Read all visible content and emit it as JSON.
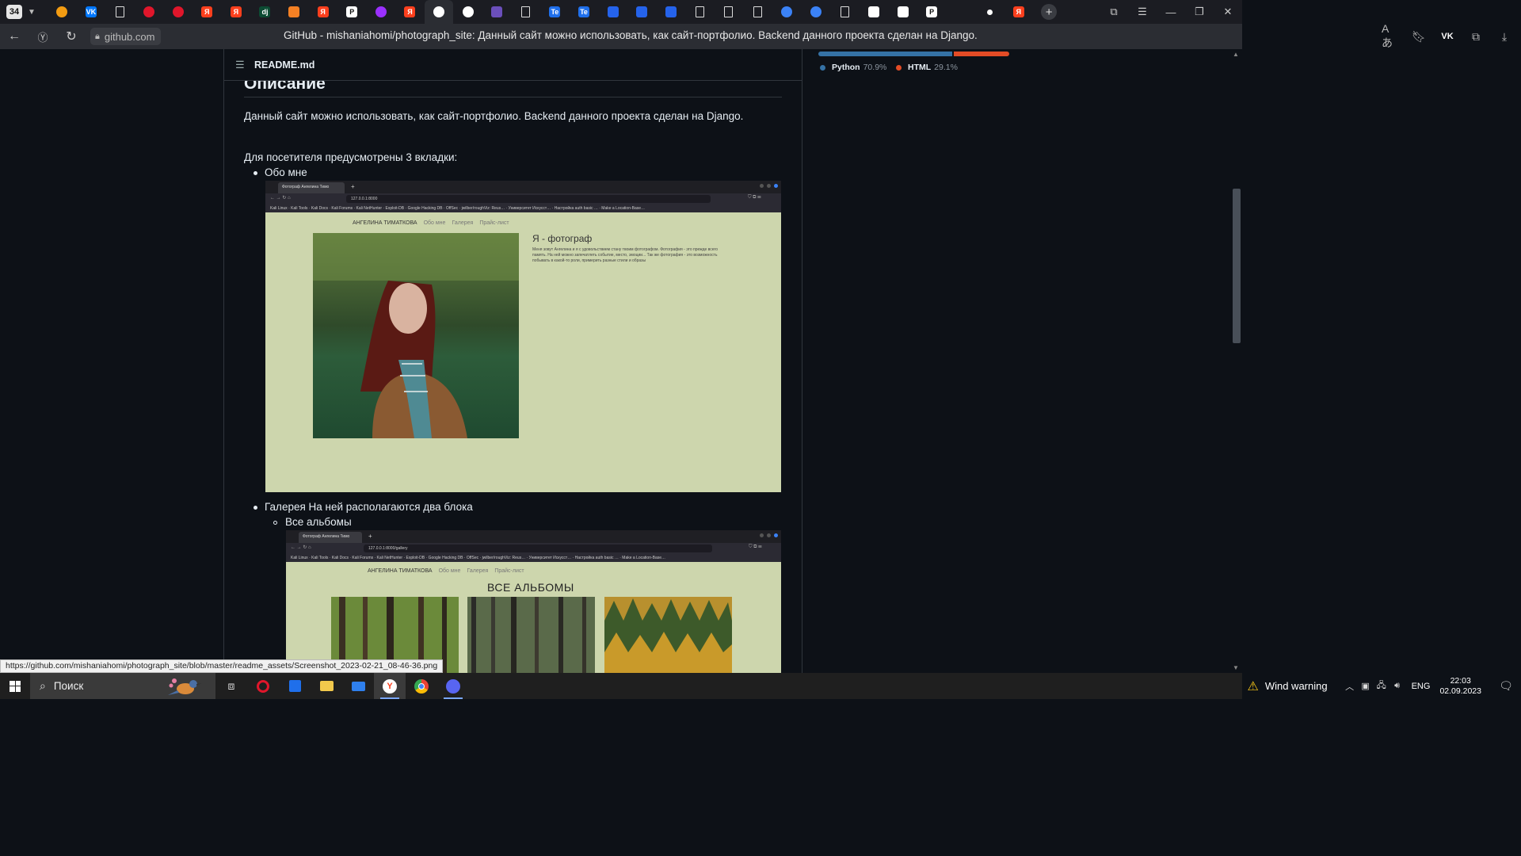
{
  "browser": {
    "tab_count": "34",
    "domain": "github.com",
    "page_title": "GitHub - mishaniahomi/photograph_site: Данный сайт можно использовать, как сайт-портфолио. Backend данного проекта сделан на Django.",
    "tabs": [
      {
        "icon": "cloud-icon",
        "color": "#f39c12",
        "label": ""
      },
      {
        "icon": "vk-icon",
        "color": "#0077ff",
        "label": "VK"
      },
      {
        "icon": "document-icon",
        "color": "",
        "label": ""
      },
      {
        "icon": "opera-icon",
        "color": "#e0162b",
        "label": ""
      },
      {
        "icon": "opera-icon",
        "color": "#e0162b",
        "label": ""
      },
      {
        "icon": "yandex-icon",
        "color": "#fc3f1d",
        "label": "Я"
      },
      {
        "icon": "yandex-icon",
        "color": "#fc3f1d",
        "label": "Я"
      },
      {
        "icon": "dj-icon",
        "color": "#0c4b33",
        "label": "dj"
      },
      {
        "icon": "stackoverflow-icon",
        "color": "#f48024",
        "label": ""
      },
      {
        "icon": "yandex-icon",
        "color": "#fc3f1d",
        "label": "Я"
      },
      {
        "icon": "p-icon",
        "color": "#ffffff",
        "label": "P"
      },
      {
        "icon": "puzzle-icon",
        "color": "#9b30ff",
        "label": ""
      },
      {
        "icon": "yandex-icon",
        "color": "#fc3f1d",
        "label": "Я"
      },
      {
        "icon": "github-icon",
        "color": "#ffffff",
        "label": ""
      },
      {
        "icon": "github-icon",
        "color": "#ffffff",
        "label": ""
      },
      {
        "icon": "banner-icon",
        "color": "#6b4fbb",
        "label": ""
      },
      {
        "icon": "document-icon",
        "color": "",
        "label": ""
      },
      {
        "icon": "te-icon",
        "color": "#1f6feb",
        "label": "Te"
      },
      {
        "icon": "te-icon",
        "color": "#1f6feb",
        "label": "Te"
      },
      {
        "icon": "app-icon",
        "color": "#2563eb",
        "label": ""
      },
      {
        "icon": "app-icon",
        "color": "#2563eb",
        "label": ""
      },
      {
        "icon": "app-icon",
        "color": "#2563eb",
        "label": ""
      },
      {
        "icon": "document-icon",
        "color": "",
        "label": ""
      },
      {
        "icon": "document-icon",
        "color": "",
        "label": ""
      },
      {
        "icon": "document-icon",
        "color": "",
        "label": ""
      },
      {
        "icon": "globe-icon",
        "color": "#3b82f6",
        "label": ""
      },
      {
        "icon": "globe-icon",
        "color": "#3b82f6",
        "label": ""
      },
      {
        "icon": "document-icon",
        "color": "",
        "label": ""
      },
      {
        "icon": "mail-icon",
        "color": "#ffffff",
        "label": ""
      },
      {
        "icon": "chat-icon",
        "color": "#ffffff",
        "label": ""
      },
      {
        "icon": "p-icon",
        "color": "#ffffff",
        "label": "P"
      },
      {
        "icon": "blank-icon",
        "color": "",
        "label": ""
      },
      {
        "icon": "dot-icon",
        "color": "#ffffff",
        "label": ""
      },
      {
        "icon": "yandex-icon",
        "color": "#fc3f1d",
        "label": "Я"
      }
    ],
    "status_url": "https://github.com/mishaniahomi/photograph_site/blob/master/readme_assets/Screenshot_2023-02-21_08-46-36.png"
  },
  "readme": {
    "file_name": "README.md",
    "heading": "Описание",
    "paragraph": "Данный сайт можно использовать, как сайт-портфолио. Backend данного проекта сделан на Django.",
    "tabs_intro": "Для посетителя предусмотрены 3 вкладки:",
    "items": [
      {
        "text": "Обо мне"
      },
      {
        "text": "Галерея На ней располагаются два блока"
      },
      {
        "text": "Все альбомы"
      }
    ]
  },
  "screenshot1": {
    "tab_title": "Фотограф Ангелина Тимо",
    "url": "127.0.0.1:8000",
    "bookmarks": "Kali Linux · Kali Tools · Kali Docs · Kali Forums · Kali NetHunter · Exploit-DB · Google Hacking DB · OffSec · jwilber/roughViz: Reus… · Университет Искусст… · Настройка auth basic … · Make a Location-Base…",
    "brand": "АНГЕЛИНА ТИМАТКОВА",
    "nav": [
      "Обо мне",
      "Галерея",
      "Прайс-лист"
    ],
    "title": "Я - фотограф",
    "text": "Меня зовут Ангелина и я с удовольствием стану твоим фотографом. Фотография - это прежде всего память. На ней можно запечатлеть событие, место, эмоции... Так же фотография - это возможность побывать в какой-то роли, примерить разные стили и образы"
  },
  "screenshot2": {
    "tab_title": "Фотограф Ангелина Тимо",
    "url": "127.0.0.1:8000/gallery",
    "bookmarks": "Kali Linux · Kali Tools · Kali Docs · Kali Forums · Kali NetHunter · Exploit-DB · Google Hacking DB · OffSec · jwilber/roughViz: Reus… · Университет Искусст… · Настройка auth basic … · Make a Location-Base…",
    "brand": "АНГЕЛИНА ТИМАТКОВА",
    "nav": [
      "Обо мне",
      "Галерея",
      "Прайс-лист"
    ],
    "title": "ВСЕ АЛЬБОМЫ"
  },
  "languages": [
    {
      "name": "Python",
      "percent": "70.9%",
      "value": 70.9,
      "color": "#3572A5"
    },
    {
      "name": "HTML",
      "percent": "29.1%",
      "value": 29.1,
      "color": "#e34c26"
    }
  ],
  "taskbar": {
    "search_placeholder": "Поиск",
    "weather": "Wind warning",
    "language": "ENG",
    "time": "22:03",
    "date": "02.09.2023"
  }
}
